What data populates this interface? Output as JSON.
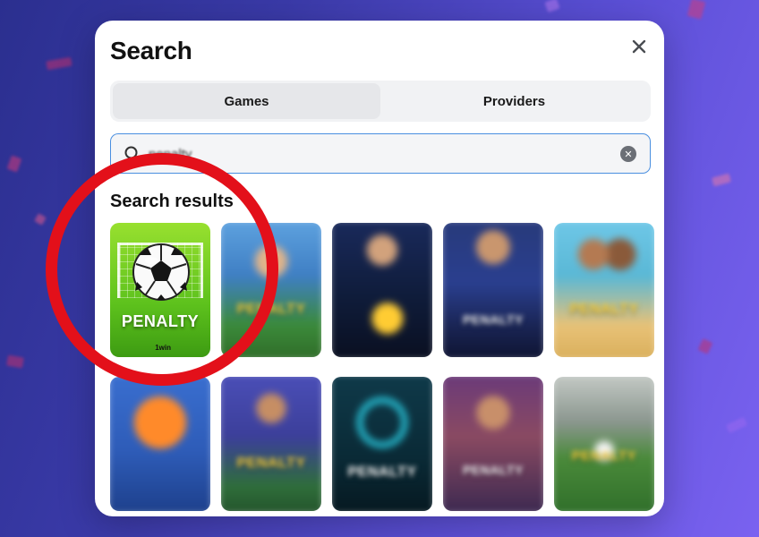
{
  "modal": {
    "title": "Search",
    "close_icon": "close-icon"
  },
  "tabs": [
    {
      "label": "Games",
      "active": true
    },
    {
      "label": "Providers",
      "active": false
    }
  ],
  "search": {
    "value": "penalty",
    "search_icon": "search-icon",
    "clear_icon": "clear-icon"
  },
  "results": {
    "heading": "Search results",
    "cards": [
      {
        "label": "PENALTY",
        "brand": "1win"
      },
      {
        "label": "PENALTY"
      },
      {
        "label": ""
      },
      {
        "label": "PENALTY"
      },
      {
        "label": "PENALTY"
      },
      {
        "label": ""
      },
      {
        "label": "PENALTY"
      },
      {
        "label": "PENALTY"
      },
      {
        "label": "PENALTY"
      },
      {
        "label": "PENALTY"
      }
    ]
  },
  "colors": {
    "background_left": "#2b2f8f",
    "background_right": "#7a62f0",
    "highlight_ring": "#e3101a",
    "search_border": "#4a8fe0"
  }
}
